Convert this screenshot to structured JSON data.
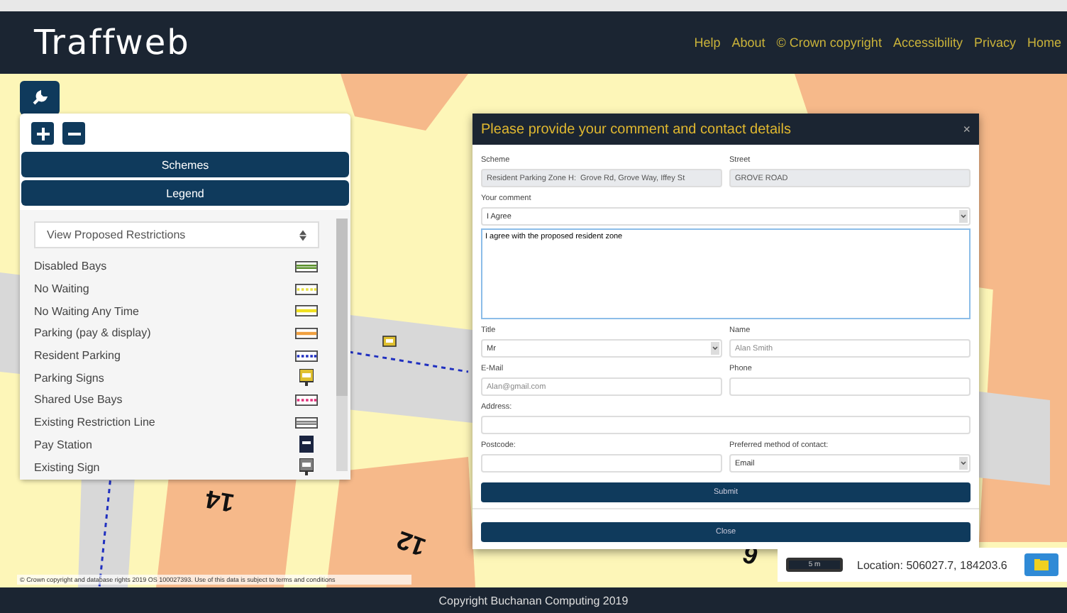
{
  "header": {
    "logo": "Traffweb",
    "nav": [
      "Help",
      "About",
      "© Crown copyright",
      "Accessibility",
      "Privacy",
      "Home"
    ]
  },
  "map": {
    "labels": [
      "14",
      "12",
      "6"
    ],
    "attribution": "© Crown copyright and database rights 2019 OS 100027393. Use of this data is subject to terms and conditions"
  },
  "side_panel": {
    "buttons": [
      "Schemes",
      "Legend"
    ],
    "dropdown": "View Proposed Restrictions",
    "legend": [
      {
        "label": "Disabled Bays",
        "kind": "double",
        "color": "#5a8f2a"
      },
      {
        "label": "No Waiting",
        "kind": "dotted",
        "color": "#e8e040"
      },
      {
        "label": "No Waiting Any Time",
        "kind": "solid",
        "color": "#f0e020"
      },
      {
        "label": "Parking (pay & display)",
        "kind": "solid",
        "color": "#f0a040"
      },
      {
        "label": "Resident Parking",
        "kind": "dotted",
        "color": "#2030c0"
      },
      {
        "label": "Parking Signs",
        "kind": "sign",
        "color": "#e0c030"
      },
      {
        "label": "Shared Use Bays",
        "kind": "dotted",
        "color": "#e0307a"
      },
      {
        "label": "Existing Restriction Line",
        "kind": "double",
        "color": "#808080"
      },
      {
        "label": "Pay Station",
        "kind": "station",
        "color": "#1a2440"
      },
      {
        "label": "Existing Sign",
        "kind": "sign",
        "color": "#808080"
      }
    ]
  },
  "dialog": {
    "title": "Please provide your comment and contact details",
    "close": "×",
    "scheme": {
      "label": "Scheme",
      "value": "Resident Parking Zone H:  Grove Rd, Grove Way, Iffey St"
    },
    "street": {
      "label": "Street",
      "value": "GROVE ROAD"
    },
    "comment": {
      "label": "Your comment",
      "value": "I Agree",
      "text": "I agree with the proposed resident zone"
    },
    "title_field": {
      "label": "Title",
      "value": "Mr"
    },
    "name": {
      "label": "Name",
      "placeholder": "Alan Smith"
    },
    "email": {
      "label": "E-Mail",
      "placeholder": "Alan@gmail.com"
    },
    "phone": {
      "label": "Phone"
    },
    "address": {
      "label": "Address:"
    },
    "postcode": {
      "label": "Postcode:"
    },
    "contact": {
      "label": "Preferred method of contact:",
      "value": "Email"
    },
    "submit": "Submit",
    "close_button": "Close"
  },
  "status": {
    "scale": "5 m",
    "location": "Location: 506027.7, 184203.6"
  },
  "footer": "Copyright Buchanan Computing 2019"
}
